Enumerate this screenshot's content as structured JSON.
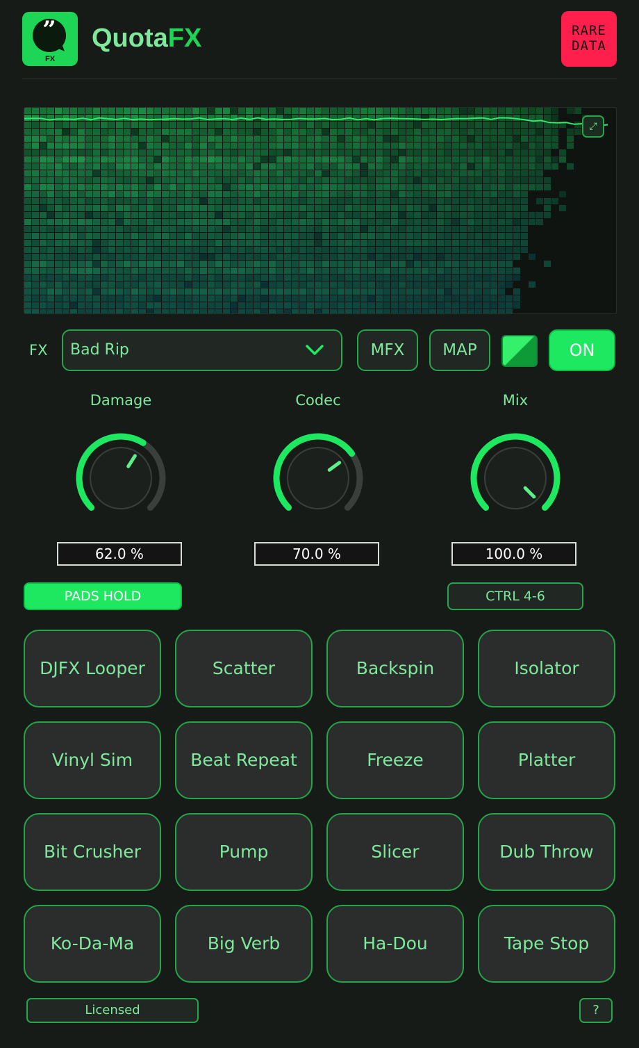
{
  "app": {
    "logo_text": "FX",
    "title_prefix": "Quota",
    "title_suffix": "FX",
    "brand_line1": "RARE",
    "brand_line2": "DATA"
  },
  "colors": {
    "background": "#161b17",
    "accent": "#1ee860",
    "accent_border": "#26a64a",
    "text": "#7fe89c",
    "brand": "#ff1f4d"
  },
  "icons": {
    "logo": "quote-bubble-icon",
    "expand": "expand-icon",
    "dropdown": "chevron-down-icon"
  },
  "toolbar": {
    "fx_label": "FX",
    "fx_selected": "Bad Rip",
    "mfx_label": "MFX",
    "map_label": "MAP",
    "on_label": "ON"
  },
  "knobs": [
    {
      "label": "Damage",
      "value": 62.0,
      "display": "62.0 %"
    },
    {
      "label": "Codec",
      "value": 70.0,
      "display": "70.0 %"
    },
    {
      "label": "Mix",
      "value": 100.0,
      "display": "100.0 %"
    }
  ],
  "pads_hold_label": "PADS HOLD",
  "ctrl_label": "CTRL 4-6",
  "pads": [
    "DJFX Looper",
    "Scatter",
    "Backspin",
    "Isolator",
    "Vinyl Sim",
    "Beat Repeat",
    "Freeze",
    "Platter",
    "Bit Crusher",
    "Pump",
    "Slicer",
    "Dub Throw",
    "Ko-Da-Ma",
    "Big Verb",
    "Ha-Dou",
    "Tape Stop"
  ],
  "footer": {
    "licensed_label": "Licensed",
    "help_label": "?"
  }
}
